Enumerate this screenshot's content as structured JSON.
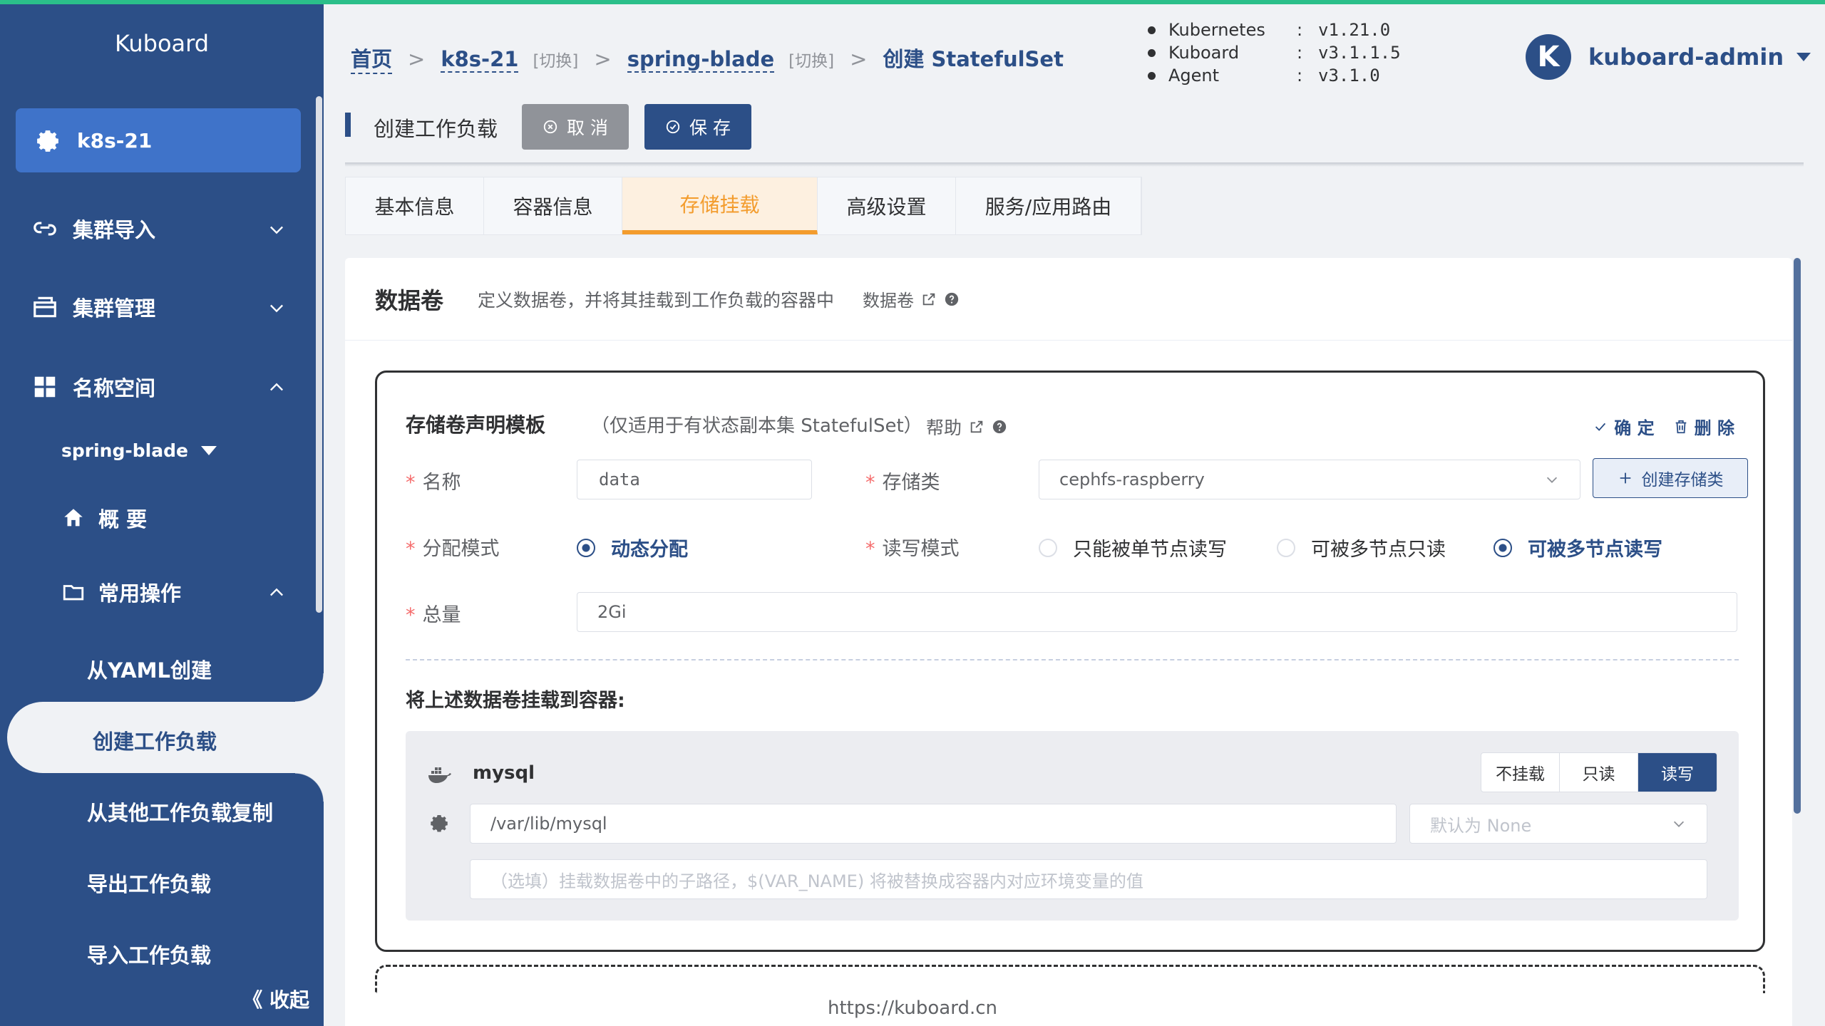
{
  "sidebar": {
    "brand": "Kuboard",
    "cluster": "k8s-21",
    "menu": [
      {
        "label": "集群导入"
      },
      {
        "label": "集群管理"
      },
      {
        "label": "名称空间"
      }
    ],
    "namespace": "spring-blade",
    "overview": "概 要",
    "common_ops": "常用操作",
    "ops": [
      {
        "label": "从YAML创建"
      },
      {
        "label": "创建工作负载"
      },
      {
        "label": "从其他工作负载复制"
      },
      {
        "label": "导出工作负载"
      },
      {
        "label": "导入工作负载"
      }
    ],
    "collapse": "《 收起"
  },
  "breadcrumb": {
    "home": "首页",
    "cluster": "k8s-21",
    "switch1": "[切换]",
    "namespace": "spring-blade",
    "switch2": "[切换]",
    "current": "创建 StatefulSet"
  },
  "versions": [
    {
      "name": "Kubernetes",
      "value": "v1.21.0"
    },
    {
      "name": "Kuboard",
      "value": "v3.1.1.5"
    },
    {
      "name": "Agent",
      "value": "v3.1.0"
    }
  ],
  "user": {
    "initial": "K",
    "name": "kuboard-admin"
  },
  "toolbar": {
    "title": "创建工作负载",
    "cancel": "取 消",
    "save": "保 存"
  },
  "tabs": [
    "基本信息",
    "容器信息",
    "存储挂载",
    "高级设置",
    "服务/应用路由"
  ],
  "active_tab": "存储挂载",
  "section": {
    "title": "数据卷",
    "desc": "定义数据卷，并将其挂载到工作负载的容器中",
    "link": "数据卷"
  },
  "volume": {
    "title": "存储卷声明模板",
    "subtitle": "（仅适用于有状态副本集 StatefulSet）",
    "help": "帮助",
    "confirm": "确 定",
    "delete": "删 除",
    "labels": {
      "name": "名称",
      "storage_class": "存储类",
      "provision_mode": "分配模式",
      "access_mode": "读写模式",
      "capacity": "总量"
    },
    "name_value": "data",
    "storage_class_value": "cephfs-raspberry",
    "create_storage_class": "创建存储类",
    "provision_option": "动态分配",
    "access_options": [
      "只能被单节点读写",
      "可被多节点只读",
      "可被多节点读写"
    ],
    "access_selected": "可被多节点读写",
    "capacity_value": "2Gi",
    "mount_title": "将上述数据卷挂载到容器:",
    "container": {
      "name": "mysql",
      "mount_options": [
        "不挂载",
        "只读",
        "读写"
      ],
      "mount_selected": "读写",
      "mount_path": "/var/lib/mysql",
      "propagation_placeholder": "默认为 None",
      "subpath_placeholder": "（选填）挂载数据卷中的子路径，$(VAR_NAME) 将被替换成容器内对应环境变量的值"
    }
  },
  "footer": "https://kuboard.cn",
  "colors": {
    "primary": "#2c4f87",
    "accent": "#f39c2d",
    "required": "#f56c6c"
  }
}
